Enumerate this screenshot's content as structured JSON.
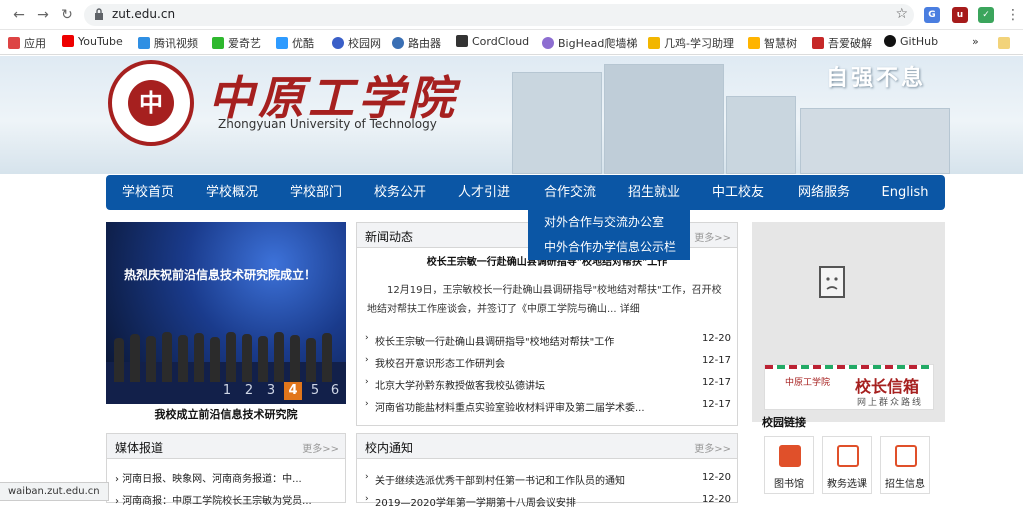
{
  "browser": {
    "url": "zut.edu.cn",
    "bookmarks": [
      "应用",
      "YouTube",
      "腾讯视频",
      "爱奇艺",
      "优酷",
      "校园网",
      "路由器",
      "CordCloud",
      "BigHead爬墙梯",
      "几鸡-学习助理",
      "智慧树",
      "吾爱破解",
      "GitHub"
    ],
    "bookmarks_overflow": "»",
    "status_url": "waiban.zut.edu.cn"
  },
  "banner": {
    "school_name_cn": "中原工学院",
    "school_name_en": "Zhongyuan University of Technology",
    "logo_glyph": "中",
    "motto": "自强不息"
  },
  "nav": {
    "items": [
      "学校首页",
      "学校概况",
      "学校部门",
      "校务公开",
      "人才引进",
      "合作交流",
      "招生就业",
      "中工校友",
      "网络服务",
      "English"
    ],
    "dropdown": [
      "对外合作与交流办公室",
      "中外合作办学信息公示栏"
    ]
  },
  "photo": {
    "title": "热烈庆祝前沿信息技术研究院成立！",
    "caption": "我校成立前沿信息技术研究院",
    "pages": [
      "1",
      "2",
      "3",
      "4",
      "5",
      "6"
    ],
    "active_page": "4"
  },
  "news": {
    "title": "新闻动态",
    "more": "更多>>",
    "headline": "校长王宗敏一行赴确山县调研指导\"校地结对帮扶\"工作",
    "summary": "12月19日，王宗敏校长一行赴确山县调研指导\"校地结对帮扶\"工作，召开校地结对帮扶工作座谈会，并签订了《中原工学院与确山... 详细",
    "items": [
      {
        "title": "校长王宗敏一行赴确山县调研指导\"校地结对帮扶\"工作",
        "date": "12-20"
      },
      {
        "title": "我校召开意识形态工作研判会",
        "date": "12-17"
      },
      {
        "title": "北京大学孙黔东教授做客我校弘德讲坛",
        "date": "12-17"
      },
      {
        "title": "河南省功能盐材料重点实验室验收材料评审及第二届学术委...",
        "date": "12-17"
      }
    ]
  },
  "mailbox": {
    "title": "校长信箱",
    "subtitle": "网上群众路线",
    "mini": "中原工学院"
  },
  "links": {
    "title": "校园链接",
    "items": [
      "图书馆",
      "教务选课",
      "招生信息"
    ]
  },
  "media": {
    "title": "媒体报道",
    "more": "更多>>",
    "items": [
      "河南日报、映象网、河南商务报道：中...",
      "河南商报：中原工学院校长王宗敏为党员..."
    ]
  },
  "notices": {
    "title": "校内通知",
    "more": "更多>>",
    "items": [
      {
        "title": "关于继续选派优秀干部到村任第一书记和工作队员的通知",
        "date": "12-20"
      },
      {
        "title": "2019—2020学年第一学期第十八周会议安排",
        "date": "12-20"
      }
    ]
  }
}
